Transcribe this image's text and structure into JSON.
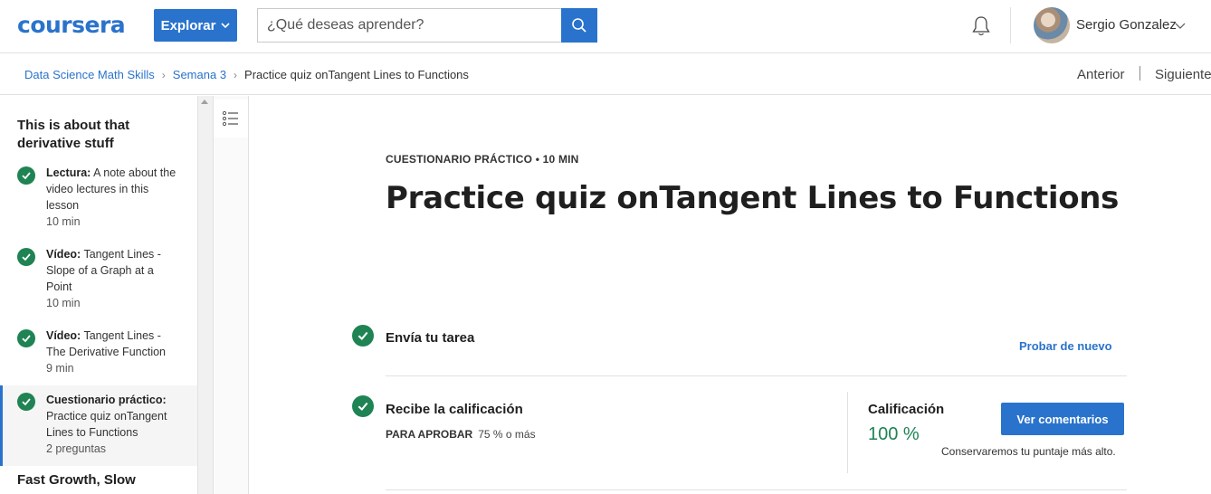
{
  "header": {
    "logo": "coursera",
    "explore_label": "Explorar",
    "search_placeholder": "¿Qué deseas aprender?",
    "user_name": "Sergio Gonzalez"
  },
  "breadcrumb": {
    "items": [
      "Data Science Math Skills",
      "Semana 3",
      "Practice quiz onTangent Lines to Functions"
    ],
    "prev": "Anterior",
    "next": "Siguiente"
  },
  "sidebar": {
    "module_title": "This is about that derivative stuff",
    "items": [
      {
        "type": "Lectura:",
        "name": "A note about the video lectures in this lesson",
        "duration": "10 min"
      },
      {
        "type": "Vídeo:",
        "name": "Tangent Lines - Slope of a Graph at a Point",
        "duration": "10 min"
      },
      {
        "type": "Vídeo:",
        "name": "Tangent Lines - The Derivative Function",
        "duration": "9 min"
      },
      {
        "type": "Cuestionario práctico:",
        "name": "Practice quiz onTangent Lines to Functions",
        "duration": "2 preguntas"
      }
    ],
    "next_module": "Fast Growth, Slow"
  },
  "main": {
    "kicker": "CUESTIONARIO PRÁCTICO • 10 MIN",
    "title": "Practice quiz onTangent Lines to Functions",
    "step1_label": "Envía tu tarea",
    "retry_label": "Probar de nuevo",
    "step2_label": "Recibe la calificación",
    "pass_label": "PARA APROBAR",
    "pass_value": "75 % o más",
    "grade_label": "Calificación",
    "grade_value": "100 %",
    "feedback_label": "Ver comentarios",
    "keep_note": "Conservaremos tu puntaje más alto."
  },
  "colors": {
    "brand": "#2a73cc",
    "success": "#1f8354"
  }
}
